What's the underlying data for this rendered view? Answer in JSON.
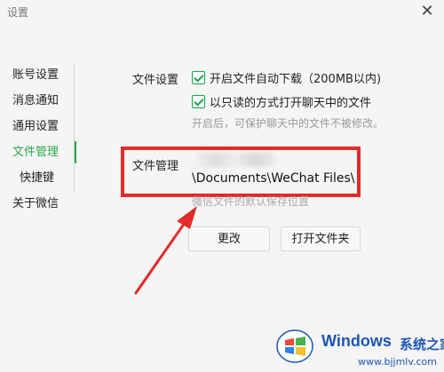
{
  "window": {
    "title": "设置",
    "close_glyph": "✕"
  },
  "sidebar": {
    "items": [
      {
        "label": "账号设置"
      },
      {
        "label": "消息通知"
      },
      {
        "label": "通用设置"
      },
      {
        "label": "文件管理",
        "active": true
      },
      {
        "label": "快捷键"
      },
      {
        "label": "关于微信"
      }
    ]
  },
  "file_settings": {
    "section_label": "文件设置",
    "auto_download_label": "开启文件自动下载（200MB以内)",
    "auto_download_checked": true,
    "read_only_label": "以只读的方式打开聊天中的文件",
    "read_only_checked": true,
    "hint": "开启后，可保护聊天中的文件不被修改。"
  },
  "file_management": {
    "section_label": "文件管理",
    "path": "\\Documents\\WeChat Files\\",
    "default_hint": "微信文件的默认保存位置"
  },
  "buttons": {
    "change_label": "更改",
    "open_folder_label": "打开文件夹"
  },
  "annotation": {
    "highlight_color": "#e22b2b"
  },
  "watermark": {
    "brand": "Windows",
    "site_name": "系统之家",
    "url": "www.bjjmlv.com",
    "color": "#1e56b6"
  },
  "colors": {
    "accent": "#29a94a",
    "background": "#f5f5f5"
  }
}
